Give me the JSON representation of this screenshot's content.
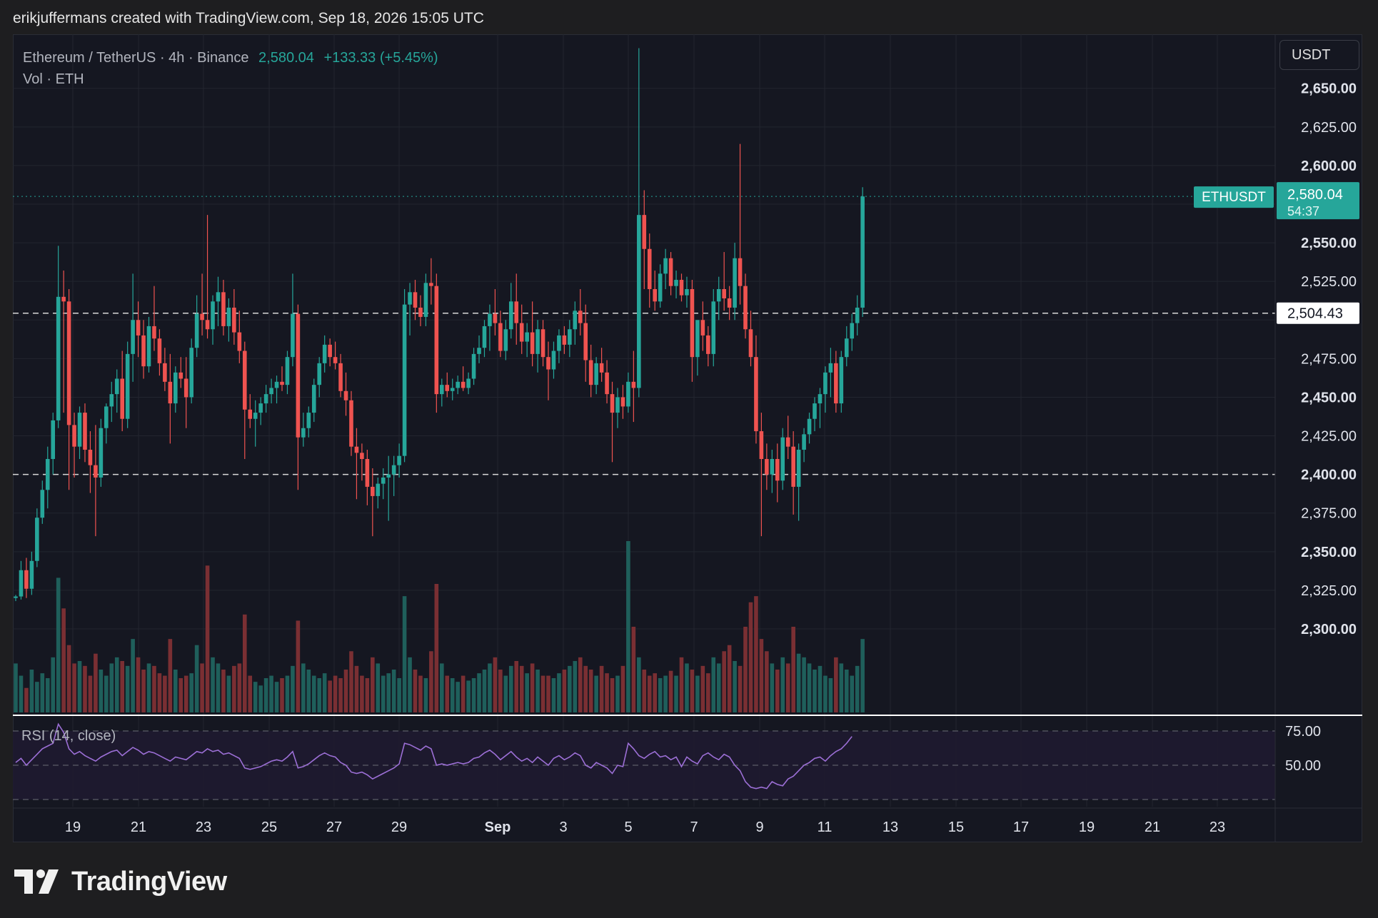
{
  "header": {
    "credit": "erikjuffermans created with TradingView.com, Sep 18, 2026 15:05 UTC"
  },
  "legend": {
    "symbol": "Ethereum / TetherUS · 4h · Binance",
    "price": "2,580.04",
    "change": "+133.33 (+5.45%)",
    "volume_label": "Vol · ETH"
  },
  "currency_button": "USDT",
  "price_tags": {
    "symbol": "ETHUSDT",
    "last_price": "2,580.04",
    "countdown": "54:37",
    "line_level_label": "2,504.43"
  },
  "rsi": {
    "label": "RSI (14, close)",
    "tick_labels": [
      "75.00",
      "50.00"
    ]
  },
  "brand": {
    "name": "TradingView"
  },
  "colors": {
    "up": "#26a69a",
    "down": "#ef5350",
    "rsi": "#9c6fd6",
    "background": "#151721"
  },
  "chart_data": {
    "type": "candlestick",
    "title": "Ethereum / TetherUS · 4h · Binance",
    "ylabel": "USDT",
    "ylim": [
      2245,
      2685
    ],
    "y_ticks": [
      "2,650.00",
      "2,625.00",
      "2,600.00",
      "2,550.00",
      "2,525.00",
      "2,475.00",
      "2,450.00",
      "2,425.00",
      "2,400.00",
      "2,375.00",
      "2,350.00",
      "2,325.00",
      "2,300.00"
    ],
    "x_ticks": [
      "19",
      "21",
      "23",
      "25",
      "27",
      "29",
      "Sep",
      "3",
      "5",
      "7",
      "9",
      "11",
      "13",
      "15",
      "17",
      "19",
      "21",
      "23"
    ],
    "horizontal_levels": [
      2504.43,
      2400.0
    ],
    "last_price": 2580.04,
    "candles": [
      [
        2320,
        2322,
        2318,
        2321
      ],
      [
        2321,
        2344,
        2319,
        2338
      ],
      [
        2338,
        2346,
        2320,
        2326
      ],
      [
        2326,
        2350,
        2322,
        2344
      ],
      [
        2344,
        2378,
        2340,
        2372
      ],
      [
        2372,
        2396,
        2368,
        2390
      ],
      [
        2390,
        2418,
        2378,
        2410
      ],
      [
        2410,
        2440,
        2400,
        2435
      ],
      [
        2435,
        2548,
        2430,
        2515
      ],
      [
        2515,
        2532,
        2440,
        2512
      ],
      [
        2512,
        2520,
        2390,
        2432
      ],
      [
        2432,
        2440,
        2398,
        2418
      ],
      [
        2418,
        2444,
        2410,
        2440
      ],
      [
        2440,
        2446,
        2408,
        2416
      ],
      [
        2416,
        2428,
        2388,
        2406
      ],
      [
        2406,
        2432,
        2360,
        2398
      ],
      [
        2398,
        2436,
        2392,
        2430
      ],
      [
        2430,
        2446,
        2420,
        2444
      ],
      [
        2444,
        2460,
        2434,
        2452
      ],
      [
        2452,
        2468,
        2440,
        2462
      ],
      [
        2462,
        2480,
        2428,
        2436
      ],
      [
        2436,
        2486,
        2430,
        2478
      ],
      [
        2478,
        2530,
        2460,
        2500
      ],
      [
        2500,
        2512,
        2476,
        2490
      ],
      [
        2490,
        2500,
        2462,
        2470
      ],
      [
        2470,
        2502,
        2466,
        2496
      ],
      [
        2496,
        2522,
        2480,
        2488
      ],
      [
        2488,
        2494,
        2464,
        2472
      ],
      [
        2472,
        2482,
        2454,
        2460
      ],
      [
        2460,
        2478,
        2420,
        2446
      ],
      [
        2446,
        2470,
        2440,
        2466
      ],
      [
        2466,
        2476,
        2456,
        2462
      ],
      [
        2462,
        2476,
        2430,
        2450
      ],
      [
        2450,
        2488,
        2446,
        2482
      ],
      [
        2482,
        2516,
        2476,
        2504
      ],
      [
        2504,
        2530,
        2490,
        2500
      ],
      [
        2500,
        2568,
        2488,
        2494
      ],
      [
        2494,
        2516,
        2484,
        2512
      ],
      [
        2512,
        2528,
        2496,
        2518
      ],
      [
        2518,
        2526,
        2490,
        2496
      ],
      [
        2496,
        2514,
        2486,
        2508
      ],
      [
        2508,
        2520,
        2484,
        2492
      ],
      [
        2492,
        2506,
        2472,
        2480
      ],
      [
        2480,
        2486,
        2410,
        2442
      ],
      [
        2442,
        2452,
        2430,
        2436
      ],
      [
        2436,
        2448,
        2418,
        2440
      ],
      [
        2440,
        2450,
        2432,
        2446
      ],
      [
        2446,
        2458,
        2440,
        2452
      ],
      [
        2452,
        2462,
        2446,
        2456
      ],
      [
        2456,
        2464,
        2446,
        2460
      ],
      [
        2460,
        2470,
        2454,
        2458
      ],
      [
        2458,
        2480,
        2452,
        2476
      ],
      [
        2476,
        2530,
        2470,
        2504
      ],
      [
        2504,
        2510,
        2390,
        2424
      ],
      [
        2424,
        2440,
        2418,
        2430
      ],
      [
        2430,
        2444,
        2424,
        2440
      ],
      [
        2440,
        2462,
        2434,
        2458
      ],
      [
        2458,
        2476,
        2450,
        2472
      ],
      [
        2472,
        2490,
        2466,
        2484
      ],
      [
        2484,
        2488,
        2470,
        2476
      ],
      [
        2476,
        2486,
        2468,
        2472
      ],
      [
        2472,
        2478,
        2450,
        2454
      ],
      [
        2454,
        2466,
        2438,
        2448
      ],
      [
        2448,
        2454,
        2412,
        2418
      ],
      [
        2418,
        2430,
        2384,
        2414
      ],
      [
        2414,
        2420,
        2396,
        2410
      ],
      [
        2410,
        2416,
        2380,
        2392
      ],
      [
        2392,
        2404,
        2360,
        2386
      ],
      [
        2386,
        2398,
        2378,
        2394
      ],
      [
        2394,
        2404,
        2384,
        2398
      ],
      [
        2398,
        2412,
        2370,
        2400
      ],
      [
        2400,
        2412,
        2386,
        2406
      ],
      [
        2406,
        2420,
        2398,
        2412
      ],
      [
        2412,
        2520,
        2408,
        2510
      ],
      [
        2510,
        2524,
        2490,
        2518
      ],
      [
        2518,
        2526,
        2500,
        2508
      ],
      [
        2508,
        2516,
        2496,
        2502
      ],
      [
        2502,
        2530,
        2496,
        2524
      ],
      [
        2524,
        2540,
        2510,
        2522
      ],
      [
        2522,
        2530,
        2440,
        2452
      ],
      [
        2452,
        2462,
        2444,
        2458
      ],
      [
        2458,
        2466,
        2450,
        2454
      ],
      [
        2454,
        2462,
        2448,
        2456
      ],
      [
        2456,
        2464,
        2452,
        2460
      ],
      [
        2460,
        2470,
        2454,
        2456
      ],
      [
        2456,
        2466,
        2452,
        2462
      ],
      [
        2462,
        2482,
        2458,
        2478
      ],
      [
        2478,
        2490,
        2472,
        2482
      ],
      [
        2482,
        2500,
        2476,
        2496
      ],
      [
        2496,
        2510,
        2480,
        2504
      ],
      [
        2504,
        2520,
        2490,
        2498
      ],
      [
        2498,
        2506,
        2476,
        2480
      ],
      [
        2480,
        2500,
        2474,
        2494
      ],
      [
        2494,
        2524,
        2488,
        2512
      ],
      [
        2512,
        2530,
        2484,
        2498
      ],
      [
        2498,
        2510,
        2478,
        2486
      ],
      [
        2486,
        2498,
        2476,
        2492
      ],
      [
        2492,
        2512,
        2470,
        2478
      ],
      [
        2478,
        2500,
        2466,
        2494
      ],
      [
        2494,
        2500,
        2470,
        2476
      ],
      [
        2476,
        2486,
        2448,
        2468
      ],
      [
        2468,
        2486,
        2462,
        2480
      ],
      [
        2480,
        2494,
        2472,
        2490
      ],
      [
        2490,
        2496,
        2478,
        2484
      ],
      [
        2484,
        2500,
        2476,
        2494
      ],
      [
        2494,
        2512,
        2484,
        2506
      ],
      [
        2506,
        2520,
        2490,
        2498
      ],
      [
        2498,
        2510,
        2460,
        2474
      ],
      [
        2474,
        2484,
        2450,
        2458
      ],
      [
        2458,
        2476,
        2452,
        2472
      ],
      [
        2472,
        2482,
        2460,
        2466
      ],
      [
        2466,
        2474,
        2446,
        2452
      ],
      [
        2452,
        2460,
        2408,
        2440
      ],
      [
        2440,
        2456,
        2430,
        2450
      ],
      [
        2450,
        2458,
        2436,
        2444
      ],
      [
        2444,
        2466,
        2440,
        2460
      ],
      [
        2460,
        2480,
        2434,
        2456
      ],
      [
        2456,
        2676,
        2450,
        2568
      ],
      [
        2568,
        2584,
        2520,
        2546
      ],
      [
        2546,
        2556,
        2508,
        2520
      ],
      [
        2520,
        2532,
        2506,
        2512
      ],
      [
        2512,
        2536,
        2508,
        2530
      ],
      [
        2530,
        2546,
        2520,
        2540
      ],
      [
        2540,
        2544,
        2516,
        2522
      ],
      [
        2522,
        2532,
        2514,
        2526
      ],
      [
        2526,
        2530,
        2512,
        2516
      ],
      [
        2516,
        2528,
        2508,
        2520
      ],
      [
        2520,
        2526,
        2460,
        2476
      ],
      [
        2476,
        2496,
        2464,
        2500
      ],
      [
        2500,
        2512,
        2480,
        2490
      ],
      [
        2490,
        2496,
        2470,
        2478
      ],
      [
        2478,
        2520,
        2470,
        2512
      ],
      [
        2512,
        2528,
        2500,
        2520
      ],
      [
        2520,
        2544,
        2506,
        2514
      ],
      [
        2514,
        2522,
        2500,
        2508
      ],
      [
        2508,
        2550,
        2500,
        2540
      ],
      [
        2540,
        2614,
        2510,
        2522
      ],
      [
        2522,
        2530,
        2488,
        2494
      ],
      [
        2494,
        2506,
        2470,
        2476
      ],
      [
        2476,
        2490,
        2420,
        2428
      ],
      [
        2428,
        2440,
        2360,
        2410
      ],
      [
        2410,
        2420,
        2390,
        2400
      ],
      [
        2400,
        2416,
        2388,
        2410
      ],
      [
        2410,
        2420,
        2382,
        2396
      ],
      [
        2396,
        2430,
        2390,
        2424
      ],
      [
        2424,
        2438,
        2410,
        2418
      ],
      [
        2418,
        2428,
        2374,
        2392
      ],
      [
        2392,
        2420,
        2370,
        2416
      ],
      [
        2416,
        2430,
        2408,
        2426
      ],
      [
        2426,
        2440,
        2420,
        2436
      ],
      [
        2436,
        2450,
        2428,
        2446
      ],
      [
        2446,
        2456,
        2430,
        2452
      ],
      [
        2452,
        2470,
        2440,
        2466
      ],
      [
        2466,
        2482,
        2450,
        2472
      ],
      [
        2472,
        2480,
        2440,
        2446
      ],
      [
        2446,
        2480,
        2440,
        2476
      ],
      [
        2476,
        2496,
        2470,
        2488
      ],
      [
        2488,
        2504,
        2480,
        2498
      ],
      [
        2498,
        2516,
        2490,
        2508
      ],
      [
        2508,
        2586,
        2502,
        2580
      ]
    ],
    "volumes": [
      40,
      30,
      20,
      35,
      25,
      32,
      28,
      45,
      110,
      85,
      55,
      40,
      42,
      38,
      30,
      48,
      35,
      30,
      40,
      45,
      42,
      38,
      60,
      45,
      35,
      40,
      38,
      32,
      30,
      60,
      35,
      28,
      30,
      32,
      55,
      40,
      120,
      45,
      40,
      35,
      30,
      38,
      40,
      80,
      30,
      25,
      22,
      28,
      30,
      25,
      28,
      30,
      38,
      75,
      40,
      35,
      30,
      28,
      32,
      26,
      30,
      28,
      35,
      50,
      38,
      30,
      28,
      45,
      40,
      30,
      32,
      35,
      28,
      95,
      45,
      35,
      30,
      28,
      50,
      105,
      40,
      30,
      28,
      25,
      30,
      26,
      28,
      32,
      35,
      40,
      45,
      35,
      30,
      38,
      42,
      38,
      32,
      40,
      35,
      30,
      30,
      28,
      32,
      35,
      38,
      42,
      45,
      38,
      35,
      30,
      38,
      32,
      28,
      30,
      38,
      140,
      70,
      45,
      35,
      30,
      32,
      28,
      30,
      34,
      30,
      45,
      40,
      35,
      30,
      38,
      32,
      45,
      40,
      50,
      55,
      42,
      38,
      70,
      90,
      95,
      60,
      50,
      40,
      35,
      45,
      40,
      70,
      48,
      45,
      40,
      35,
      38,
      30,
      28,
      45,
      40,
      35,
      30,
      38,
      60
    ],
    "rsi": [
      52,
      55,
      50,
      54,
      58,
      62,
      64,
      66,
      80,
      74,
      62,
      58,
      60,
      57,
      55,
      53,
      56,
      58,
      60,
      61,
      57,
      60,
      63,
      61,
      58,
      60,
      59,
      57,
      55,
      53,
      56,
      55,
      54,
      57,
      60,
      59,
      62,
      60,
      61,
      58,
      59,
      57,
      55,
      48,
      47,
      48,
      49,
      51,
      53,
      54,
      53,
      56,
      60,
      48,
      49,
      51,
      54,
      57,
      59,
      57,
      56,
      52,
      50,
      45,
      44,
      45,
      43,
      40,
      42,
      44,
      46,
      48,
      51,
      66,
      65,
      63,
      61,
      64,
      62,
      50,
      51,
      50,
      51,
      52,
      51,
      52,
      55,
      56,
      59,
      61,
      58,
      54,
      57,
      60,
      56,
      53,
      55,
      52,
      56,
      53,
      50,
      55,
      57,
      54,
      56,
      59,
      57,
      50,
      48,
      52,
      50,
      48,
      44,
      50,
      49,
      66,
      62,
      57,
      55,
      58,
      60,
      56,
      57,
      54,
      56,
      49,
      56,
      53,
      51,
      57,
      59,
      56,
      54,
      58,
      56,
      50,
      46,
      38,
      34,
      33,
      34,
      33,
      38,
      36,
      35,
      40,
      42,
      46,
      50,
      52,
      55,
      56,
      53,
      57,
      60,
      62,
      66,
      71
    ]
  }
}
